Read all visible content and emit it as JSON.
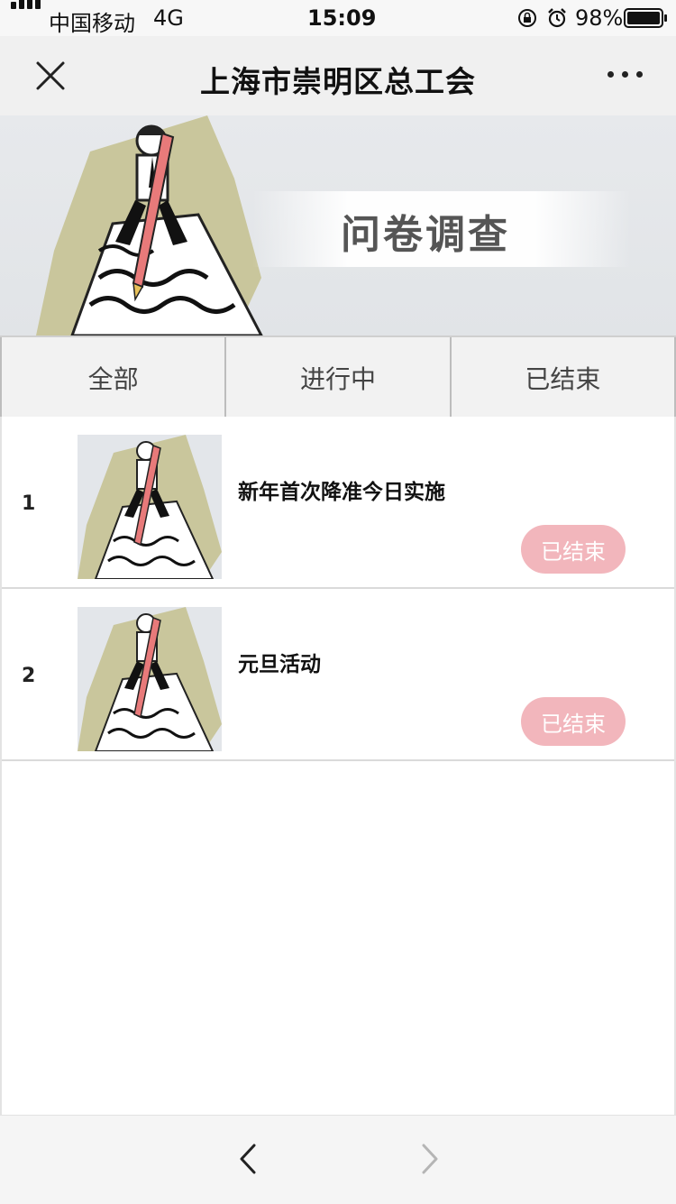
{
  "status_bar": {
    "carrier": "中国移动",
    "network": "4G",
    "time": "15:09",
    "battery": "98%"
  },
  "nav": {
    "title": "上海市崇明区总工会",
    "close_icon": "close-icon",
    "more_icon": "more-icon"
  },
  "banner": {
    "title": "问卷调查"
  },
  "tabs": [
    {
      "label": "全部"
    },
    {
      "label": "进行中"
    },
    {
      "label": "已结束"
    }
  ],
  "surveys": [
    {
      "index": "1",
      "title": "新年首次降准今日实施",
      "status": "已结束"
    },
    {
      "index": "2",
      "title": "元旦活动",
      "status": "已结束"
    }
  ],
  "colors": {
    "badge": "#f2b6bc",
    "banner_bg": "#e4e6e9"
  }
}
